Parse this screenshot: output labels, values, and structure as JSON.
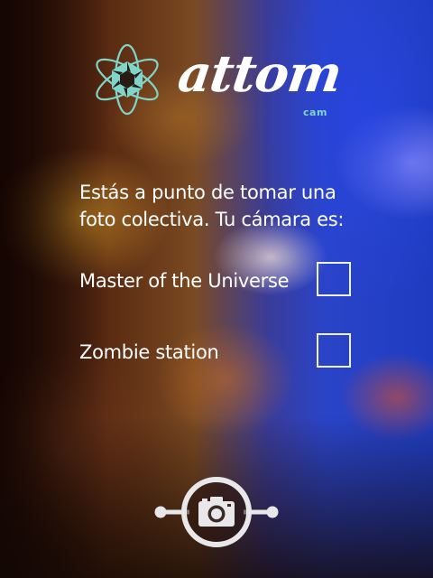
{
  "logo": {
    "wordmark": "attom",
    "sub": "cam",
    "accent_color": "#7fd6c8",
    "icon": "atom-shutter-icon"
  },
  "prompt": {
    "line1": "Estás a punto de tomar una",
    "line2": "foto colectiva. Tu cámara es:"
  },
  "options": [
    {
      "label": "Master of the Universe",
      "checked": false
    },
    {
      "label": "Zombie station",
      "checked": false
    }
  ],
  "shutter_button": {
    "icon": "camera-icon"
  }
}
